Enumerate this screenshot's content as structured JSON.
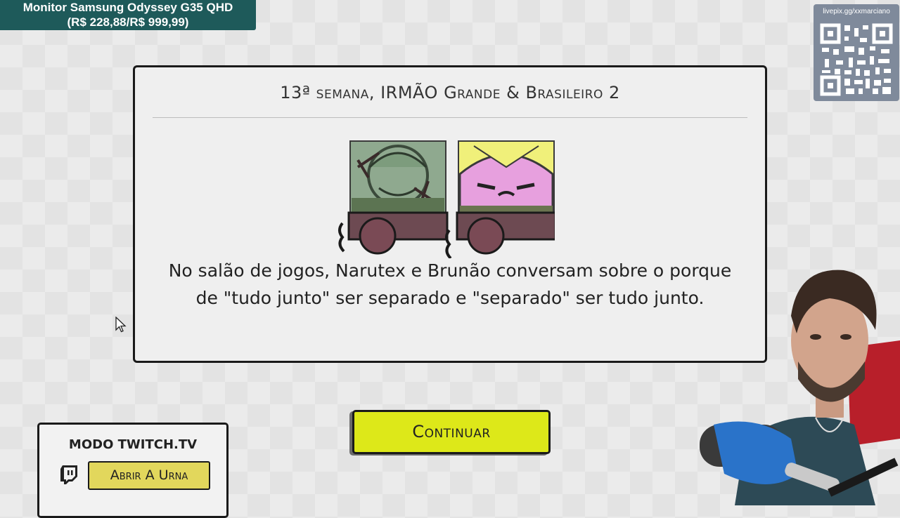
{
  "promo": {
    "product": "Monitor Samsung Odyssey G35 QHD",
    "price": "(R$ 228,88/R$ 999,99)"
  },
  "donation": {
    "url": "livepix.gg/xxmarciano"
  },
  "dialog": {
    "title": "13ª semana, IRMÃO Grande & Brasileiro 2",
    "message": "No salão de jogos, Narutex e Brunão conversam sobre o porque de \"tudo junto\" ser separado e \"separado\" ser tudo junto.",
    "characters": [
      {
        "icon": "green-character-portrait-icon",
        "color": "#8fa98f"
      },
      {
        "icon": "pink-character-portrait-icon",
        "color": "#e7a0de"
      }
    ]
  },
  "continue_button": {
    "label": "Continuar",
    "color": "#dde819"
  },
  "twitch_panel": {
    "title": "MODO TWITCH.TV",
    "button_label": "Abrir A Urna",
    "button_color": "#e2d75c"
  }
}
